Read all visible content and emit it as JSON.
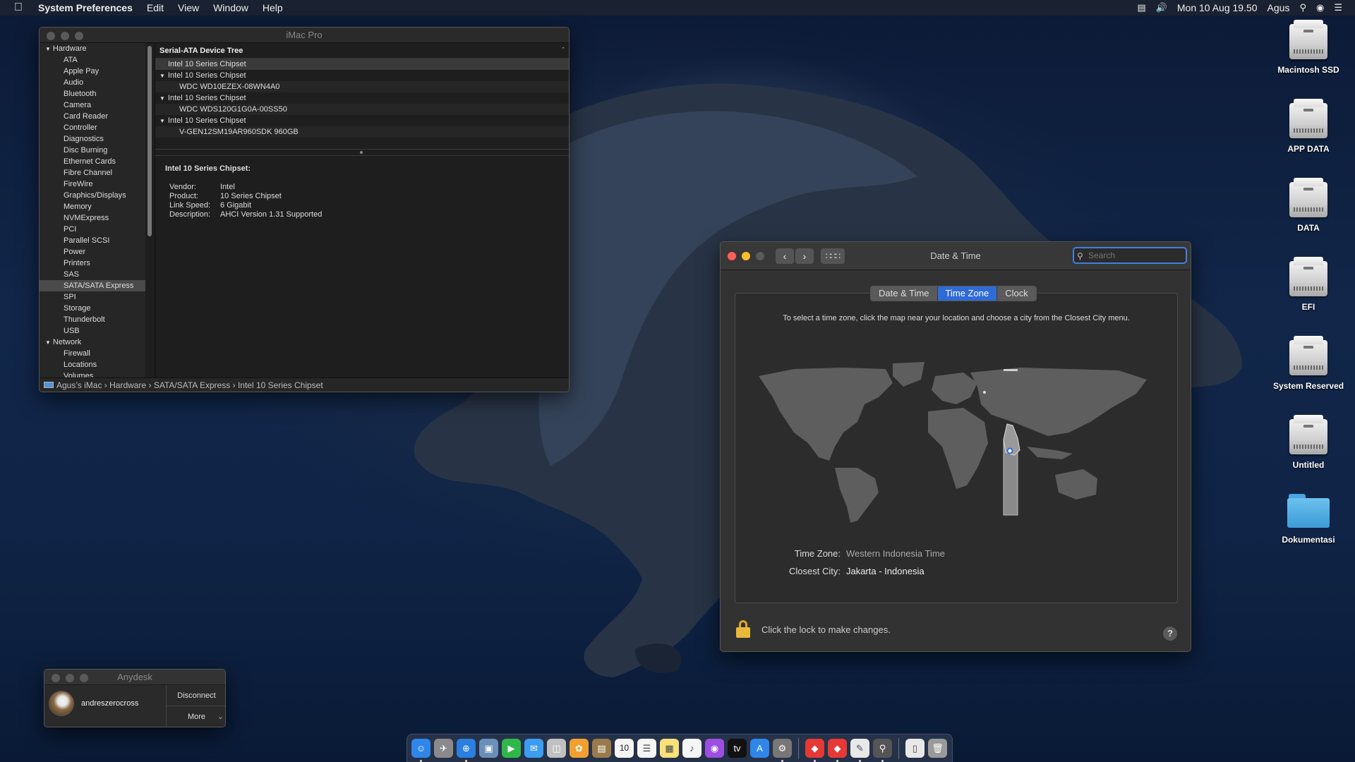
{
  "menubar": {
    "app_name": "System Preferences",
    "menus": [
      "Edit",
      "View",
      "Window",
      "Help"
    ],
    "clock": "Mon 10 Aug  19.50",
    "user": "Agus"
  },
  "sysinfo": {
    "title": "iMac Pro",
    "sidebar": [
      {
        "label": "Hardware",
        "kind": "cat"
      },
      {
        "label": "ATA"
      },
      {
        "label": "Apple Pay"
      },
      {
        "label": "Audio"
      },
      {
        "label": "Bluetooth"
      },
      {
        "label": "Camera"
      },
      {
        "label": "Card Reader"
      },
      {
        "label": "Controller"
      },
      {
        "label": "Diagnostics"
      },
      {
        "label": "Disc Burning"
      },
      {
        "label": "Ethernet Cards"
      },
      {
        "label": "Fibre Channel"
      },
      {
        "label": "FireWire"
      },
      {
        "label": "Graphics/Displays"
      },
      {
        "label": "Memory"
      },
      {
        "label": "NVMExpress"
      },
      {
        "label": "PCI"
      },
      {
        "label": "Parallel SCSI"
      },
      {
        "label": "Power"
      },
      {
        "label": "Printers"
      },
      {
        "label": "SAS"
      },
      {
        "label": "SATA/SATA Express",
        "selected": true
      },
      {
        "label": "SPI"
      },
      {
        "label": "Storage"
      },
      {
        "label": "Thunderbolt"
      },
      {
        "label": "USB"
      },
      {
        "label": "Network",
        "kind": "cat"
      },
      {
        "label": "Firewall"
      },
      {
        "label": "Locations"
      },
      {
        "label": "Volumes"
      }
    ],
    "tree_header": "Serial-ATA Device Tree",
    "tree": [
      {
        "label": "Intel 10 Series Chipset",
        "level": 0,
        "open": false,
        "selected": true
      },
      {
        "label": "Intel 10 Series Chipset",
        "level": 0,
        "open": true
      },
      {
        "label": "WDC WD10EZEX-08WN4A0",
        "level": 1
      },
      {
        "label": "Intel 10 Series Chipset",
        "level": 0,
        "open": true
      },
      {
        "label": "WDC WDS120G1G0A-00SS50",
        "level": 1
      },
      {
        "label": "Intel 10 Series Chipset",
        "level": 0,
        "open": true
      },
      {
        "label": "V-GEN12SM19AR960SDK 960GB",
        "level": 1
      }
    ],
    "detail": {
      "title": "Intel 10 Series Chipset:",
      "fields": [
        {
          "k": "Vendor:",
          "v": "Intel"
        },
        {
          "k": "Product:",
          "v": "10 Series Chipset"
        },
        {
          "k": "Link Speed:",
          "v": "6 Gigabit"
        },
        {
          "k": "Description:",
          "v": "AHCI Version 1.31 Supported"
        }
      ]
    },
    "path": "Agus’s iMac  ›  Hardware  ›  SATA/SATA Express  ›  Intel 10 Series Chipset"
  },
  "datetime": {
    "title": "Date & Time",
    "search_placeholder": "Search",
    "tabs": [
      {
        "label": "Date & Time",
        "active": false
      },
      {
        "label": "Time Zone",
        "active": true
      },
      {
        "label": "Clock",
        "active": false
      }
    ],
    "instruction": "To select a time zone, click the map near your location and choose a city from the Closest City menu.",
    "time_zone_label": "Time Zone:",
    "time_zone_value": "Western Indonesia Time",
    "closest_city_label": "Closest City:",
    "closest_city_value": "Jakarta - Indonesia",
    "lock_text": "Click the lock to make changes.",
    "help": "?"
  },
  "anydesk": {
    "title": "Anydesk",
    "user": "andreszerocross",
    "disconnect": "Disconnect",
    "more": "More"
  },
  "desktop_icons": [
    {
      "label": "Macintosh SSD",
      "kind": "drive"
    },
    {
      "label": "APP DATA",
      "kind": "drive"
    },
    {
      "label": "DATA",
      "kind": "drive"
    },
    {
      "label": "EFI",
      "kind": "drive"
    },
    {
      "label": "System Reserved",
      "kind": "drive"
    },
    {
      "label": "Untitled",
      "kind": "drive"
    },
    {
      "label": "Dokumentasi",
      "kind": "folder"
    }
  ],
  "dock": {
    "calendar_day": "10",
    "apps": [
      {
        "name": "finder-icon",
        "color": "#2f86e8",
        "glyph": "☺",
        "run": true
      },
      {
        "name": "launchpad-icon",
        "color": "#8a8a8a",
        "glyph": "✈",
        "run": false
      },
      {
        "name": "safari-icon",
        "color": "#2a7fe0",
        "glyph": "⊕",
        "run": true
      },
      {
        "name": "preview-icon",
        "color": "#6a8fb8",
        "glyph": "▣",
        "run": false
      },
      {
        "name": "facetime-icon",
        "color": "#2fb84a",
        "glyph": "▶",
        "run": false
      },
      {
        "name": "messages-icon",
        "color": "#3b9cf0",
        "glyph": "✉",
        "run": false
      },
      {
        "name": "photo-booth-icon",
        "color": "#c0c0c0",
        "glyph": "◫",
        "run": false
      },
      {
        "name": "photos-icon",
        "color": "#f0a030",
        "glyph": "✿",
        "run": false
      },
      {
        "name": "notes-brown-icon",
        "color": "#9a7a4a",
        "glyph": "▤",
        "run": false
      },
      {
        "name": "calendar-icon",
        "color": "#f5f5f5",
        "glyph": "",
        "run": false,
        "calendar": true
      },
      {
        "name": "reminders-icon",
        "color": "#f5f5f5",
        "glyph": "☰",
        "run": false
      },
      {
        "name": "notes-icon",
        "color": "#f8e07a",
        "glyph": "▦",
        "run": false
      },
      {
        "name": "music-icon",
        "color": "#f5f5f5",
        "glyph": "♪",
        "run": false
      },
      {
        "name": "podcasts-icon",
        "color": "#9b4ee0",
        "glyph": "◉",
        "run": false
      },
      {
        "name": "tv-icon",
        "color": "#111111",
        "glyph": "tv",
        "run": false
      },
      {
        "name": "app-store-icon",
        "color": "#2f86e8",
        "glyph": "A",
        "run": false
      },
      {
        "name": "system-preferences-icon",
        "color": "#777777",
        "glyph": "⚙",
        "run": true
      },
      {
        "sep": true
      },
      {
        "name": "anydesk-icon",
        "color": "#e53935",
        "glyph": "◆",
        "run": true
      },
      {
        "name": "anydesk-alt-icon",
        "color": "#e53935",
        "glyph": "◆",
        "run": true
      },
      {
        "name": "textedit-icon",
        "color": "#e8e8e8",
        "glyph": "✎",
        "run": true
      },
      {
        "name": "script-editor-icon",
        "color": "#555555",
        "glyph": "⚲",
        "run": true
      },
      {
        "sep": true
      },
      {
        "name": "documents-stack-icon",
        "color": "#e8e8e8",
        "glyph": "▯",
        "run": false
      },
      {
        "name": "trash-icon",
        "color": "#9a9a9a",
        "glyph": "🗑",
        "run": false
      }
    ]
  }
}
